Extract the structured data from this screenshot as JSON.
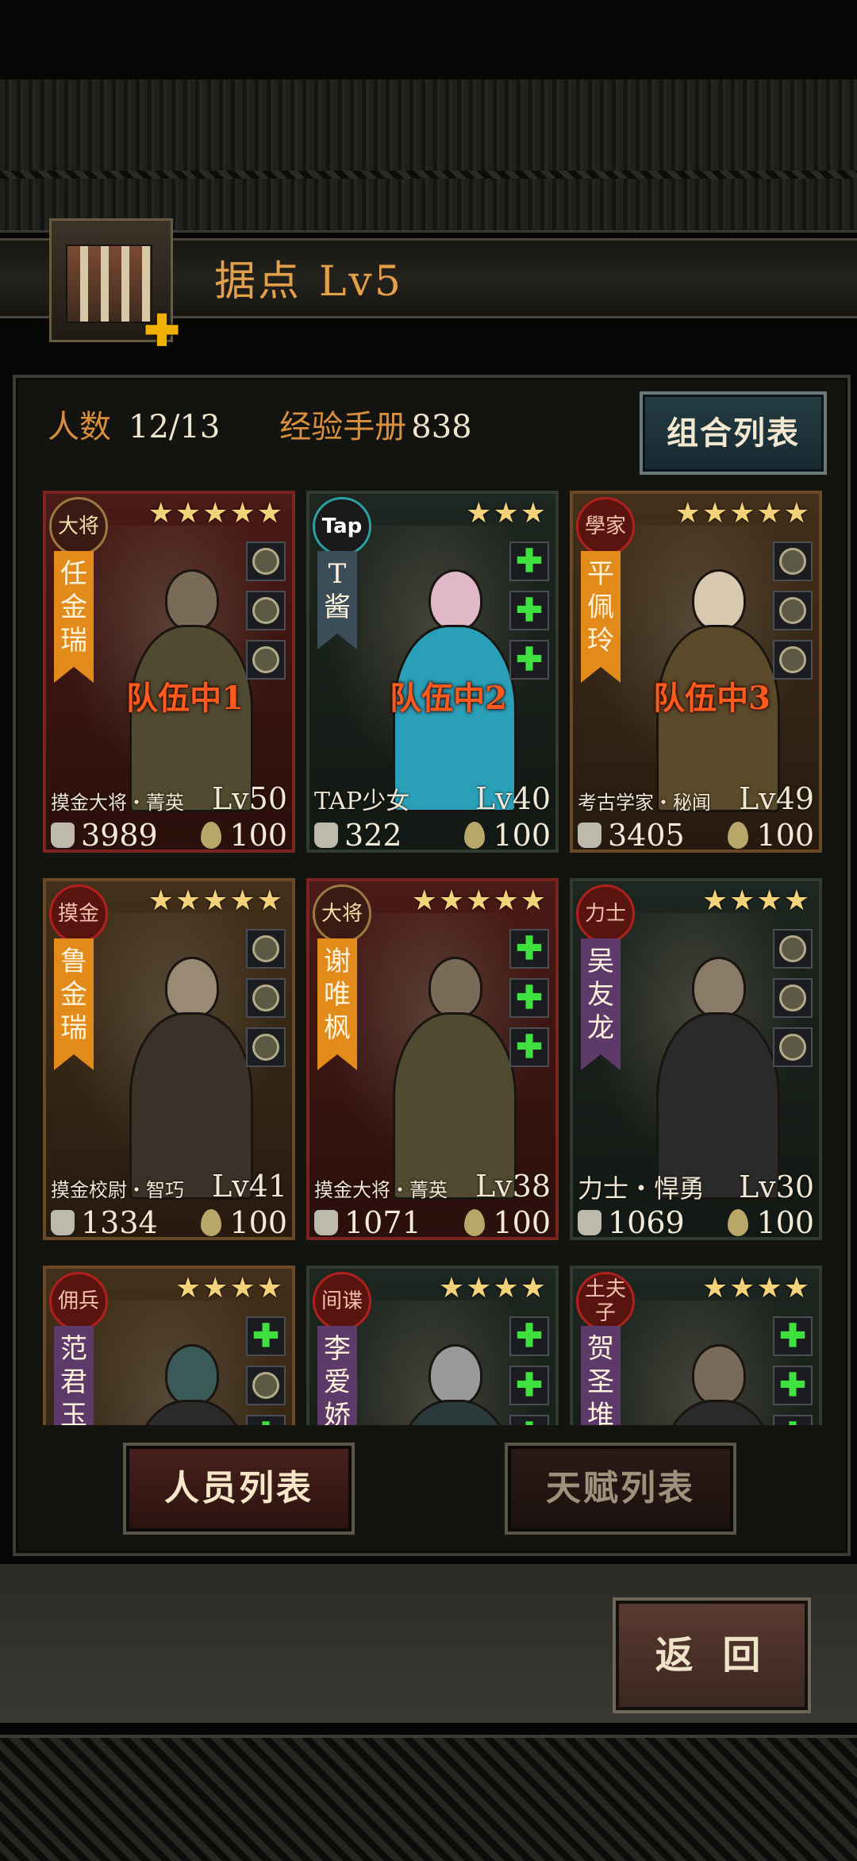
{
  "header": {
    "title": "据点",
    "level": "Lv5"
  },
  "stats": {
    "population_label": "人数",
    "population_value": "12/13",
    "exp_label": "经验手册",
    "exp_value": "838"
  },
  "combo_button": "组合列表",
  "cards": [
    {
      "badge": "大将",
      "name": "任金瑞",
      "stars": "★★★★★",
      "team": "队伍中1",
      "class": "摸金大将・菁英",
      "level": "Lv50",
      "power": "3989",
      "stamina": "100"
    },
    {
      "badge": "Tap",
      "name": "T酱",
      "stars": "★★★",
      "team": "队伍中2",
      "class": "TAP少女",
      "level": "Lv40",
      "power": "322",
      "stamina": "100"
    },
    {
      "badge": "學家",
      "name": "平佩玲",
      "stars": "★★★★★",
      "team": "队伍中3",
      "class": "考古学家・秘闻",
      "level": "Lv49",
      "power": "3405",
      "stamina": "100"
    },
    {
      "badge": "摸金",
      "name": "鲁金瑞",
      "stars": "★★★★★",
      "team": "",
      "class": "摸金校尉・智巧",
      "level": "Lv41",
      "power": "1334",
      "stamina": "100"
    },
    {
      "badge": "大将",
      "name": "谢唯枫",
      "stars": "★★★★★",
      "team": "",
      "class": "摸金大将・菁英",
      "level": "Lv38",
      "power": "1071",
      "stamina": "100"
    },
    {
      "badge": "力士",
      "name": "吴友龙",
      "stars": "★★★★",
      "team": "",
      "class": "力士・悍勇",
      "level": "Lv30",
      "power": "1069",
      "stamina": "100"
    },
    {
      "badge": "佣兵",
      "name": "范君玉",
      "stars": "★★★★",
      "team": "",
      "class": "",
      "level": "",
      "power": "",
      "stamina": ""
    },
    {
      "badge": "间谍",
      "name": "李爱娇",
      "stars": "★★★★",
      "team": "",
      "class": "",
      "level": "",
      "power": "",
      "stamina": ""
    },
    {
      "badge": "土夫子",
      "name": "贺圣堆",
      "stars": "★★★★",
      "team": "",
      "class": "",
      "level": "",
      "power": "",
      "stamina": ""
    }
  ],
  "tabs": {
    "personnel": "人员列表",
    "talent": "天赋列表"
  },
  "back_button": "返 回",
  "colors": {
    "accent_orange": "#e3a04a",
    "team_red": "#ff5a1e",
    "star_gold": "#f4d27a",
    "add_green": "#40e040"
  }
}
